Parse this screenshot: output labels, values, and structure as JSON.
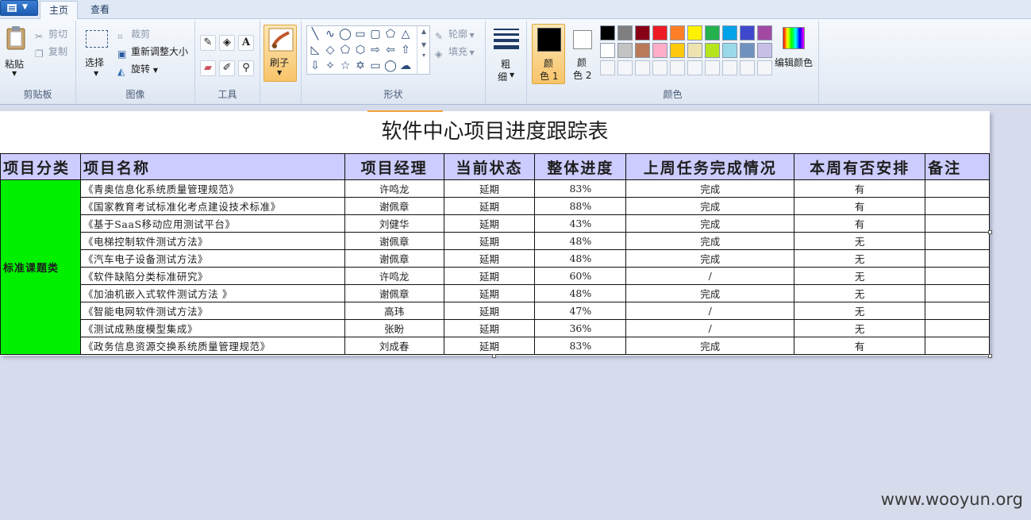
{
  "tabs": [
    {
      "label": "主页",
      "active": true
    },
    {
      "label": "查看",
      "active": false
    }
  ],
  "ribbon": {
    "clipboard": {
      "paste": "粘贴",
      "cut": "剪切",
      "copy": "复制",
      "group": "剪贴板"
    },
    "image": {
      "select": "选择",
      "crop": "裁剪",
      "resize": "重新调整大小",
      "rotate": "旋转",
      "group": "图像"
    },
    "tools": {
      "group": "工具"
    },
    "brushes": {
      "label": "刷子"
    },
    "shapes": {
      "outline": "轮廓",
      "fill": "填充",
      "group": "形状"
    },
    "size": {
      "label_1": "粗",
      "label_2": "细"
    },
    "colors": {
      "color1_1": "颜",
      "color1_2": "色 1",
      "color2_1": "颜",
      "color2_2": "色 2",
      "edit": "编辑颜色",
      "group": "颜色",
      "palette_row1": [
        "#000000",
        "#7f7f7f",
        "#880015",
        "#ed1c24",
        "#ff7f27",
        "#fff200",
        "#22b14c",
        "#00a2e8",
        "#3f48cc",
        "#a349a4"
      ],
      "palette_row2": [
        "#ffffff",
        "#c3c3c3",
        "#b97a57",
        "#ffaec9",
        "#ffc90e",
        "#efe4b0",
        "#b5e61d",
        "#99d9ea",
        "#7092be",
        "#c8bfe7"
      ],
      "color1_value": "#000000",
      "color2_value": "#ffffff"
    }
  },
  "sheet": {
    "title": "软件中心项目进度跟踪表",
    "headers": [
      "项目分类",
      "项目名称",
      "项目经理",
      "当前状态",
      "整体进度",
      "上周任务完成情况",
      "本周有否安排",
      "备注"
    ],
    "category": "标准课题类",
    "rows": [
      {
        "name": "《青奥信息化系统质量管理规范》",
        "manager": "许鸣龙",
        "status": "延期",
        "progress": "83%",
        "last_week": "完成",
        "this_week": "有",
        "note": ""
      },
      {
        "name": "《国家教育考试标准化考点建设技术标准》",
        "manager": "谢佩章",
        "status": "延期",
        "progress": "88%",
        "last_week": "完成",
        "this_week": "有",
        "note": ""
      },
      {
        "name": "《基于SaaS移动应用测试平台》",
        "manager": "刘健华",
        "status": "延期",
        "progress": "43%",
        "last_week": "完成",
        "this_week": "有",
        "note": ""
      },
      {
        "name": "《电梯控制软件测试方法》",
        "manager": "谢佩章",
        "status": "延期",
        "progress": "48%",
        "last_week": "完成",
        "this_week": "无",
        "note": ""
      },
      {
        "name": "《汽车电子设备测试方法》",
        "manager": "谢佩章",
        "status": "延期",
        "progress": "48%",
        "last_week": "完成",
        "this_week": "无",
        "note": ""
      },
      {
        "name": "《软件缺陷分类标准研究》",
        "manager": "许鸣龙",
        "status": "延期",
        "progress": "60%",
        "last_week": "/",
        "this_week": "无",
        "note": ""
      },
      {
        "name": "《加油机嵌入式软件测试方法 》",
        "manager": "谢佩章",
        "status": "延期",
        "progress": "48%",
        "last_week": "完成",
        "this_week": "无",
        "note": ""
      },
      {
        "name": "《智能电网软件测试方法》",
        "manager": "高玮",
        "status": "延期",
        "progress": "47%",
        "last_week": "/",
        "this_week": "无",
        "note": ""
      },
      {
        "name": "《测试成熟度模型集成》",
        "manager": "张盼",
        "status": "延期",
        "progress": "36%",
        "last_week": "/",
        "this_week": "无",
        "note": ""
      },
      {
        "name": "《政务信息资源交换系统质量管理规范》",
        "manager": "刘成春",
        "status": "延期",
        "progress": "83%",
        "last_week": "完成",
        "this_week": "有",
        "note": ""
      }
    ]
  },
  "watermark": "www.wooyun.org"
}
